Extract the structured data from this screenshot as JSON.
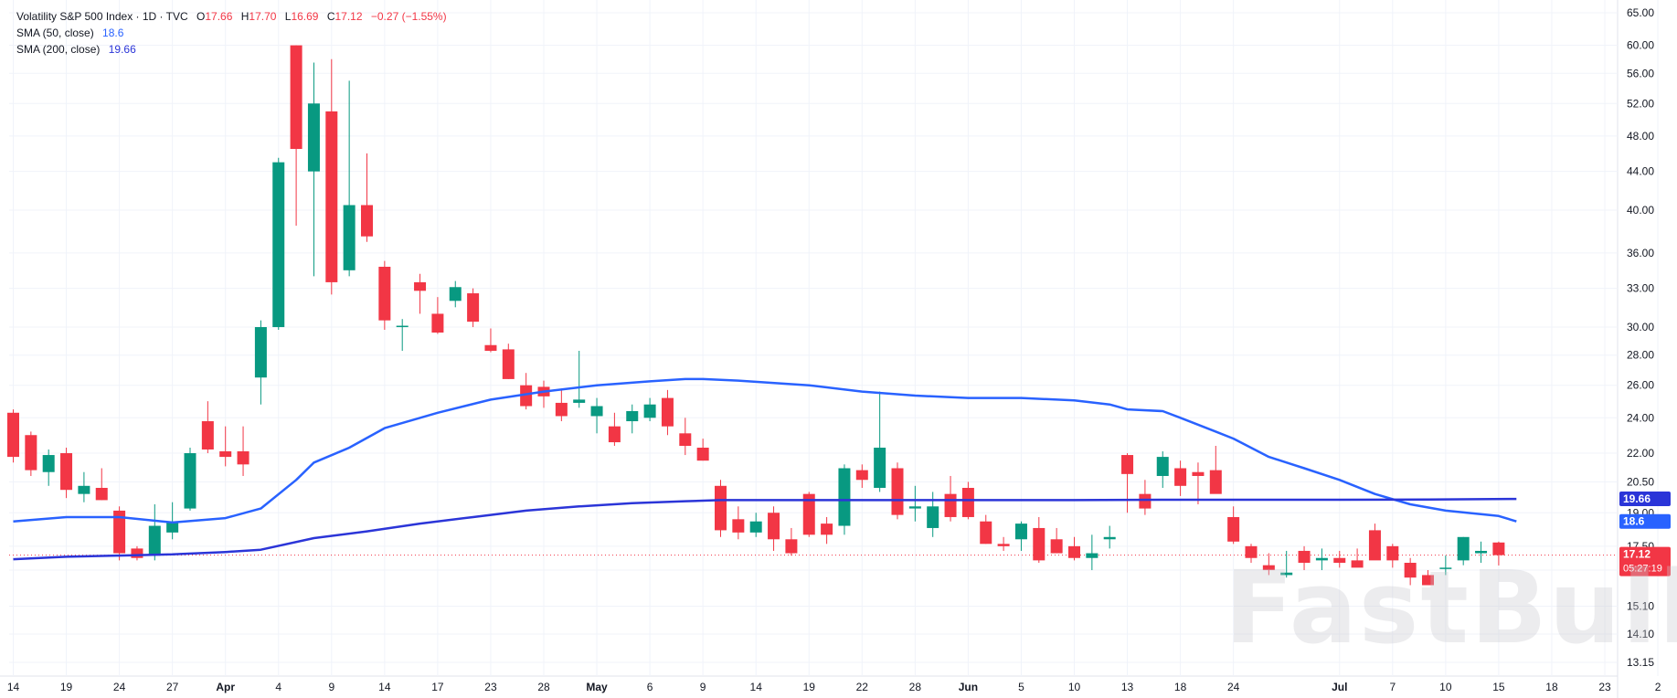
{
  "legend": {
    "title": "Volatility S&P 500 Index · 1D · TVC",
    "o_label": "O",
    "o_value": "17.66",
    "h_label": "H",
    "h_value": "17.70",
    "l_label": "L",
    "l_value": "16.69",
    "c_label": "C",
    "c_value": "17.12",
    "change": "−0.27 (−1.55%)",
    "sma50_label": "SMA (50, close)",
    "sma50_value": "18.6",
    "sma200_label": "SMA (200, close)",
    "sma200_value": "19.66"
  },
  "watermark": "FastBull",
  "colors": {
    "up": "#089981",
    "down": "#f23645",
    "sma50": "#2962ff",
    "sma200": "#2b35d8",
    "grid": "#f0f3fa",
    "axis_text": "#131722"
  },
  "chart_data": {
    "type": "candlestick",
    "scale": "log",
    "ylim": [
      12.5,
      66.5
    ],
    "grid": true,
    "y_ticks": [
      "65.00",
      "60.00",
      "56.00",
      "52.00",
      "48.00",
      "44.00",
      "40.00",
      "36.00",
      "33.00",
      "30.00",
      "28.00",
      "26.00",
      "24.00",
      "22.00",
      "20.50",
      "19.00",
      "17.50",
      "16.50",
      "15.10",
      "14.10",
      "13.15"
    ],
    "x_ticks": [
      {
        "label": "14",
        "i": 0
      },
      {
        "label": "19",
        "i": 3
      },
      {
        "label": "24",
        "i": 6
      },
      {
        "label": "27",
        "i": 9
      },
      {
        "label": "Apr",
        "i": 12
      },
      {
        "label": "4",
        "i": 15
      },
      {
        "label": "9",
        "i": 18
      },
      {
        "label": "14",
        "i": 21
      },
      {
        "label": "17",
        "i": 24
      },
      {
        "label": "23",
        "i": 27
      },
      {
        "label": "28",
        "i": 30
      },
      {
        "label": "May",
        "i": 33
      },
      {
        "label": "6",
        "i": 36
      },
      {
        "label": "9",
        "i": 39
      },
      {
        "label": "14",
        "i": 42
      },
      {
        "label": "19",
        "i": 45
      },
      {
        "label": "22",
        "i": 48
      },
      {
        "label": "28",
        "i": 51
      },
      {
        "label": "Jun",
        "i": 54
      },
      {
        "label": "5",
        "i": 57
      },
      {
        "label": "10",
        "i": 60
      },
      {
        "label": "13",
        "i": 63
      },
      {
        "label": "18",
        "i": 66
      },
      {
        "label": "24",
        "i": 69
      },
      {
        "label": "Jul",
        "i": 75
      },
      {
        "label": "7",
        "i": 78
      },
      {
        "label": "10",
        "i": 81
      },
      {
        "label": "15",
        "i": 84
      },
      {
        "label": "18",
        "i": 87
      },
      {
        "label": "23",
        "i": 90
      },
      {
        "label": "2",
        "i": 93
      }
    ],
    "ohlc": [
      [
        24.3,
        24.5,
        21.5,
        21.8
      ],
      [
        23.0,
        23.2,
        20.8,
        21.1
      ],
      [
        21.0,
        22.2,
        20.3,
        21.9
      ],
      [
        22.0,
        22.3,
        19.7,
        20.1
      ],
      [
        19.9,
        21.0,
        19.5,
        20.3
      ],
      [
        20.2,
        21.2,
        19.6,
        19.6
      ],
      [
        19.1,
        19.3,
        16.9,
        17.2
      ],
      [
        17.4,
        17.5,
        16.9,
        17.0
      ],
      [
        17.1,
        19.4,
        16.9,
        18.4
      ],
      [
        18.1,
        19.5,
        17.8,
        18.6
      ],
      [
        19.2,
        22.3,
        19.1,
        22.0
      ],
      [
        23.8,
        25.0,
        22.0,
        22.2
      ],
      [
        22.1,
        23.5,
        21.3,
        21.8
      ],
      [
        22.1,
        23.5,
        20.8,
        21.4
      ],
      [
        26.5,
        30.5,
        24.8,
        30.0
      ],
      [
        30.0,
        45.5,
        29.8,
        45.0
      ],
      [
        60.0,
        60.0,
        38.5,
        46.5
      ],
      [
        44.0,
        57.5,
        34.0,
        52.0
      ],
      [
        51.0,
        58.0,
        32.5,
        33.5
      ],
      [
        34.5,
        55.0,
        34.0,
        40.5
      ],
      [
        40.5,
        46.0,
        37.0,
        37.5
      ],
      [
        34.8,
        35.3,
        29.8,
        30.5
      ],
      [
        30.0,
        30.6,
        28.3,
        30.1
      ],
      [
        33.5,
        34.2,
        31.0,
        32.8
      ],
      [
        31.0,
        32.3,
        29.5,
        29.6
      ],
      [
        32.0,
        33.6,
        31.5,
        33.1
      ],
      [
        32.6,
        33.0,
        30.0,
        30.4
      ],
      [
        28.7,
        29.9,
        28.2,
        28.3
      ],
      [
        28.4,
        28.8,
        26.4,
        26.4
      ],
      [
        26.0,
        26.8,
        24.5,
        24.7
      ],
      [
        25.9,
        26.3,
        24.6,
        25.3
      ],
      [
        24.9,
        25.7,
        23.8,
        24.1
      ],
      [
        24.9,
        28.3,
        24.6,
        25.1
      ],
      [
        24.1,
        25.2,
        23.1,
        24.7
      ],
      [
        23.5,
        24.3,
        22.4,
        22.6
      ],
      [
        23.8,
        24.8,
        23.1,
        24.4
      ],
      [
        24.0,
        25.2,
        23.8,
        24.8
      ],
      [
        25.2,
        25.7,
        23.0,
        23.5
      ],
      [
        23.1,
        24.0,
        21.9,
        22.4
      ],
      [
        22.3,
        22.8,
        21.6,
        21.6
      ],
      [
        20.3,
        20.6,
        17.9,
        18.2
      ],
      [
        18.7,
        19.3,
        17.8,
        18.1
      ],
      [
        18.1,
        19.0,
        17.9,
        18.6
      ],
      [
        19.0,
        19.3,
        17.3,
        17.8
      ],
      [
        17.8,
        18.3,
        17.1,
        17.2
      ],
      [
        19.9,
        20.0,
        17.9,
        18.0
      ],
      [
        18.5,
        18.8,
        17.6,
        18.0
      ],
      [
        18.4,
        21.4,
        18.0,
        21.2
      ],
      [
        21.1,
        21.4,
        20.2,
        20.6
      ],
      [
        20.2,
        25.6,
        20.0,
        22.3
      ],
      [
        21.2,
        21.5,
        18.7,
        18.9
      ],
      [
        19.2,
        20.3,
        18.6,
        19.3
      ],
      [
        18.3,
        20.0,
        17.9,
        19.3
      ],
      [
        19.9,
        20.8,
        18.6,
        18.8
      ],
      [
        20.2,
        20.5,
        18.7,
        18.8
      ],
      [
        18.6,
        18.9,
        17.6,
        17.6
      ],
      [
        17.6,
        17.9,
        17.3,
        17.5
      ],
      [
        17.8,
        18.6,
        17.3,
        18.5
      ],
      [
        18.3,
        18.8,
        16.8,
        16.9
      ],
      [
        17.8,
        18.3,
        17.2,
        17.2
      ],
      [
        17.5,
        17.9,
        16.9,
        17.0
      ],
      [
        17.0,
        18.0,
        16.5,
        17.2
      ],
      [
        17.8,
        18.4,
        17.4,
        17.9
      ],
      [
        21.9,
        22.0,
        19.0,
        20.9
      ],
      [
        19.9,
        20.6,
        18.9,
        19.2
      ],
      [
        20.8,
        22.1,
        20.2,
        21.8
      ],
      [
        21.2,
        21.6,
        19.8,
        20.3
      ],
      [
        21.0,
        21.5,
        19.4,
        20.8
      ],
      [
        21.1,
        22.4,
        20.0,
        19.9
      ],
      [
        18.8,
        19.3,
        17.6,
        17.7
      ],
      [
        17.5,
        17.6,
        16.8,
        17.0
      ],
      [
        16.7,
        17.2,
        16.3,
        16.5
      ],
      [
        16.3,
        17.3,
        16.2,
        16.4
      ],
      [
        17.3,
        17.5,
        16.5,
        16.8
      ],
      [
        16.9,
        17.4,
        16.5,
        17.0
      ],
      [
        17.0,
        17.3,
        16.6,
        16.8
      ],
      [
        16.9,
        17.4,
        16.7,
        16.6
      ],
      [
        18.2,
        18.5,
        17.6,
        16.9
      ],
      [
        17.5,
        17.6,
        16.6,
        16.9
      ],
      [
        16.8,
        17.0,
        15.9,
        16.2
      ],
      [
        16.3,
        16.5,
        15.9,
        15.9
      ],
      [
        16.6,
        17.1,
        16.3,
        16.6
      ],
      [
        16.9,
        17.9,
        16.7,
        17.9
      ],
      [
        17.2,
        17.7,
        16.8,
        17.3
      ],
      [
        17.66,
        17.7,
        16.69,
        17.12
      ]
    ],
    "sma50": [
      [
        0,
        18.6
      ],
      [
        3,
        18.8
      ],
      [
        6,
        18.8
      ],
      [
        9,
        18.55
      ],
      [
        12,
        18.75
      ],
      [
        14,
        19.2
      ],
      [
        16,
        20.6
      ],
      [
        17,
        21.5
      ],
      [
        19,
        22.3
      ],
      [
        21,
        23.4
      ],
      [
        24,
        24.3
      ],
      [
        27,
        25.1
      ],
      [
        30,
        25.6
      ],
      [
        33,
        26.0
      ],
      [
        36,
        26.25
      ],
      [
        38,
        26.4
      ],
      [
        39,
        26.4
      ],
      [
        41,
        26.3
      ],
      [
        45,
        26.0
      ],
      [
        48,
        25.6
      ],
      [
        51,
        25.35
      ],
      [
        54,
        25.2
      ],
      [
        57,
        25.2
      ],
      [
        60,
        25.05
      ],
      [
        62,
        24.8
      ],
      [
        63,
        24.5
      ],
      [
        65,
        24.4
      ],
      [
        66,
        24.0
      ],
      [
        68,
        23.2
      ],
      [
        69,
        22.8
      ],
      [
        71,
        21.8
      ],
      [
        73,
        21.2
      ],
      [
        75,
        20.6
      ],
      [
        77,
        19.9
      ],
      [
        79,
        19.4
      ],
      [
        81,
        19.1
      ],
      [
        84,
        18.85
      ],
      [
        85,
        18.6
      ]
    ],
    "sma200": [
      [
        0,
        16.95
      ],
      [
        3,
        17.05
      ],
      [
        6,
        17.1
      ],
      [
        9,
        17.15
      ],
      [
        12,
        17.25
      ],
      [
        14,
        17.35
      ],
      [
        17,
        17.85
      ],
      [
        20,
        18.15
      ],
      [
        23,
        18.5
      ],
      [
        26,
        18.8
      ],
      [
        29,
        19.1
      ],
      [
        32,
        19.3
      ],
      [
        35,
        19.45
      ],
      [
        38,
        19.55
      ],
      [
        40,
        19.6
      ],
      [
        45,
        19.6
      ],
      [
        50,
        19.6
      ],
      [
        54,
        19.6
      ],
      [
        60,
        19.6
      ],
      [
        65,
        19.62
      ],
      [
        70,
        19.62
      ],
      [
        75,
        19.62
      ],
      [
        80,
        19.63
      ],
      [
        85,
        19.66
      ]
    ],
    "current_price": 17.12,
    "price_labels": [
      {
        "value": "19.66",
        "y": 19.66,
        "color": "#2b35d8"
      },
      {
        "value": "18.6",
        "y": 18.6,
        "color": "#2962ff"
      },
      {
        "value": "17.12",
        "y": 17.12,
        "color": "#f23645"
      }
    ],
    "countdown": "05:27:19"
  }
}
